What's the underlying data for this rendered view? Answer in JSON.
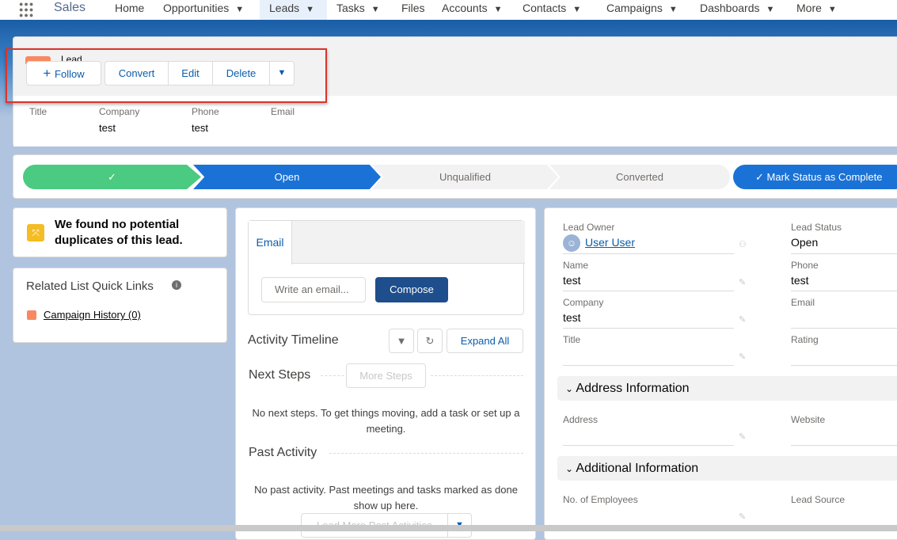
{
  "nav": {
    "app_name": "Sales",
    "items": [
      "Home",
      "Opportunities",
      "Leads",
      "Tasks",
      "Files",
      "Accounts",
      "Contacts",
      "Campaigns",
      "Dashboards",
      "More"
    ]
  },
  "header": {
    "object_label": "Lead",
    "actions": {
      "follow": "Follow",
      "convert": "Convert",
      "edit": "Edit",
      "delete": "Delete"
    },
    "fields": [
      {
        "label": "Title",
        "value": ""
      },
      {
        "label": "Company",
        "value": "test"
      },
      {
        "label": "Phone",
        "value": "test"
      },
      {
        "label": "Email",
        "value": ""
      }
    ]
  },
  "path": {
    "stages": [
      "Open",
      "Unqualified",
      "Converted"
    ],
    "mark_complete": "Mark Status as Complete"
  },
  "duplicates": {
    "text": "We found no potential duplicates of this lead."
  },
  "quick_links": {
    "title": "Related List Quick Links",
    "items": [
      "Campaign History (0)"
    ]
  },
  "activity": {
    "tab_email": "Email",
    "email_placeholder": "Write an email...",
    "compose": "Compose",
    "timeline_title": "Activity Timeline",
    "expand_all": "Expand All",
    "next_steps": "Next Steps",
    "more_steps": "More Steps",
    "next_empty": "No next steps. To get things moving, add a task or set up a meeting.",
    "past_activity": "Past Activity",
    "past_empty": "No past activity. Past meetings and tasks marked as done show up here.",
    "load_more": "Load More Past Activities"
  },
  "details": {
    "lead_owner_label": "Lead Owner",
    "lead_owner": "User User",
    "lead_status_label": "Lead Status",
    "lead_status": "Open",
    "name_label": "Name",
    "name": "test",
    "phone_label": "Phone",
    "phone": "test",
    "company_label": "Company",
    "company": "test",
    "email_label": "Email",
    "title_label": "Title",
    "rating_label": "Rating",
    "address_section": "Address Information",
    "address_label": "Address",
    "website_label": "Website",
    "additional_section": "Additional Information",
    "employees_label": "No. of Employees",
    "lead_source_label": "Lead Source"
  }
}
